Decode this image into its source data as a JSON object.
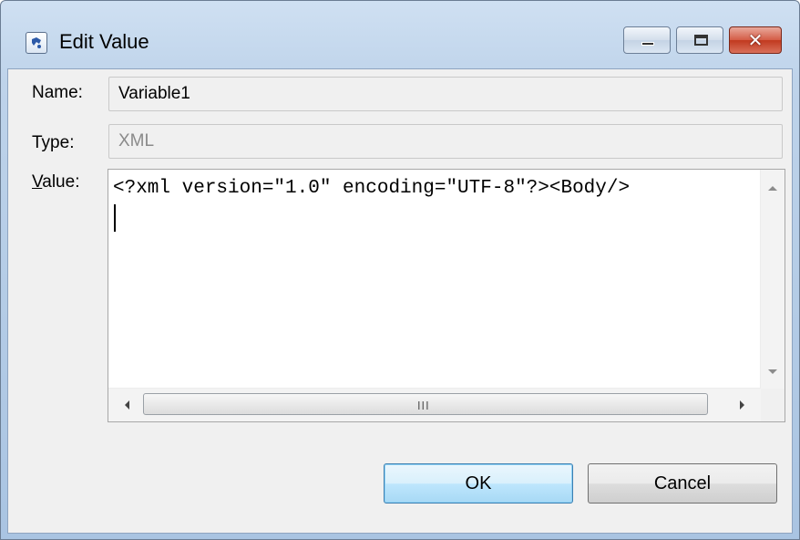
{
  "window": {
    "title": "Edit Value",
    "app_icon": "app-icon",
    "controls": {
      "minimize": "minimize-icon",
      "maximize": "maximize-icon",
      "close": "close-icon"
    }
  },
  "form": {
    "name_label": "Name:",
    "name_value": "Variable1",
    "type_label": "Type:",
    "type_value": "XML",
    "value_label_access_key": "V",
    "value_label_rest": "alue:",
    "value_text": "<?xml version=\"1.0\" encoding=\"UTF-8\"?><Body/>",
    "hscroll_grip": "III"
  },
  "buttons": {
    "ok": "OK",
    "cancel": "Cancel"
  },
  "colors": {
    "ok_border": "#3c7fb1",
    "close_button": "#c1391f"
  }
}
